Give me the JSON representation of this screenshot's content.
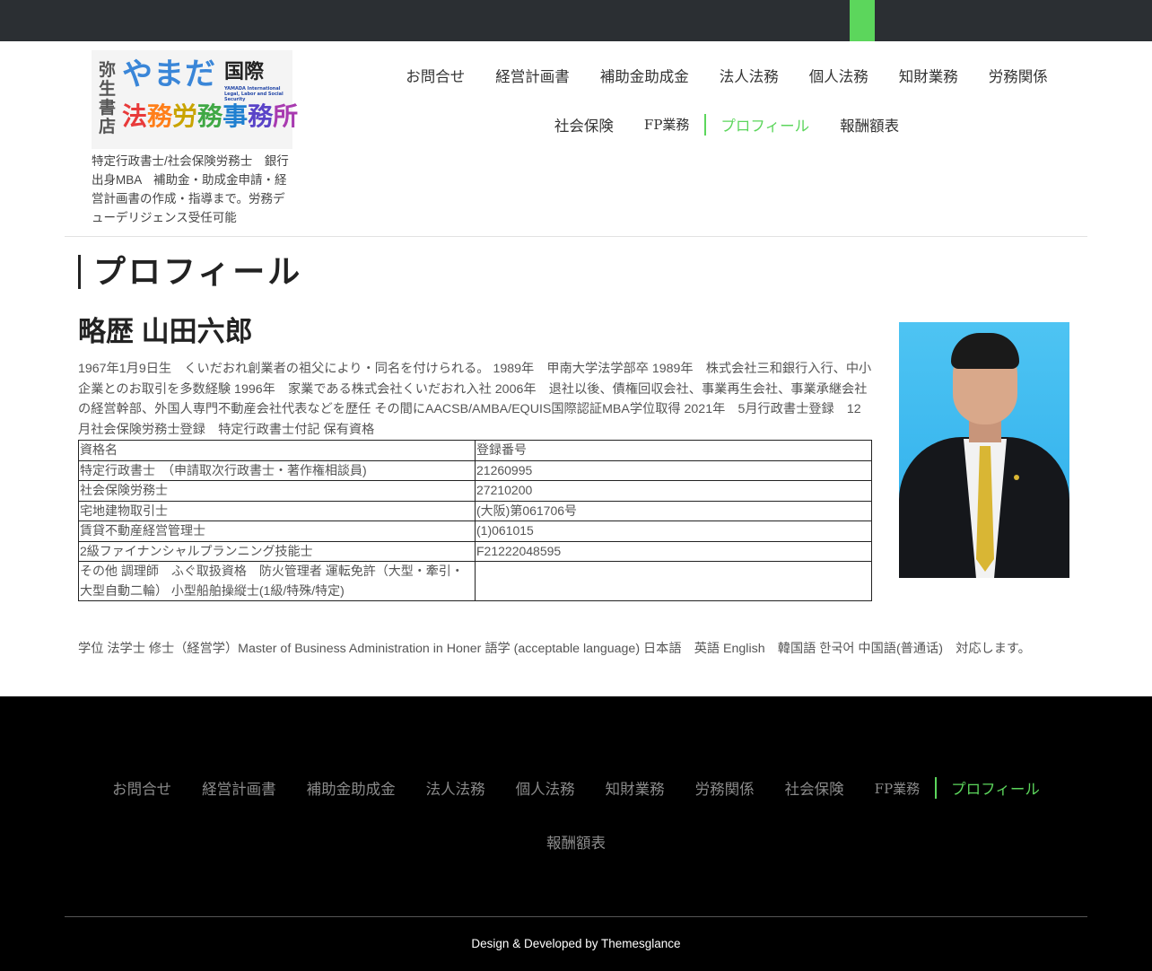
{
  "colors": {
    "accent": "#5cd65c",
    "topbar": "#2b2f33",
    "footer": "#000000"
  },
  "logo": {
    "vertical_text": "弥生書店",
    "yamada": "やまだ",
    "kokusai": "国際",
    "english": "YAMADA International Legal, Labor and Social Security",
    "main": [
      "法",
      "務",
      "労",
      "務",
      "事",
      "務",
      "所"
    ]
  },
  "tagline": "特定行政書士/社会保険労務士　銀行出身MBA　補助金・助成金申請・経営計画書の作成・指導まで。労務デューデリジェンス受任可能",
  "nav": {
    "row1": [
      "お問合せ",
      "経営計画書",
      "補助金助成金",
      "法人法務",
      "個人法務",
      "知財業務",
      "労務関係"
    ],
    "row2": [
      "社会保険",
      "FP業務",
      "プロフィール",
      "報酬額表"
    ]
  },
  "page_title": "プロフィール",
  "profile": {
    "heading": "略歴 山田六郎",
    "bio": "1967年1月9日生　くいだおれ創業者の祖父により・同名を付けられる。 1989年　甲南大学法学部卒 1989年　株式会社三和銀行入行、中小企業とのお取引を多数経験 1996年　家業である株式会社くいだおれ入社 2006年　退社以後、債権回収会社、事業再生会社、事業承継会社の経営幹部、外国人専門不動産会社代表などを歴任 その間にAACSB/AMBA/EQUIS国際認証MBA学位取得 2021年　5月行政書士登録　12月社会保険労務士登録　特定行政書士付記 保有資格",
    "table": {
      "header": [
        "資格名",
        "登録番号"
      ],
      "rows": [
        [
          "特定行政書士　（申請取次行政書士・著作権相談員)",
          "21260995"
        ],
        [
          "社会保険労務士",
          "27210200"
        ],
        [
          "宅地建物取引士",
          "(大阪)第061706号"
        ],
        [
          "賃貸不動産経営管理士",
          "(1)061015"
        ],
        [
          "2級ファイナンシャルプランニング技能士",
          "F21222048595"
        ],
        [
          "その他 調理師　ふぐ取扱資格　防火管理者 運転免許（大型・牽引・大型自動二輪） 小型船舶操縦士(1級/特殊/特定)",
          ""
        ]
      ]
    },
    "degrees": "学位 法学士 修士（経営学）Master of Business Administration in Honer 語学 (acceptable language) 日本語　英語 English　韓国語 한국어 中国語(普通话)　対応します。"
  },
  "footer": {
    "row1": [
      "お問合せ",
      "経営計画書",
      "補助金助成金",
      "法人法務",
      "個人法務",
      "知財業務",
      "労務関係",
      "社会保険",
      "FP業務",
      "プロフィール"
    ],
    "row2": [
      "報酬額表"
    ],
    "credit": "Design & Developed by Themesglance"
  }
}
